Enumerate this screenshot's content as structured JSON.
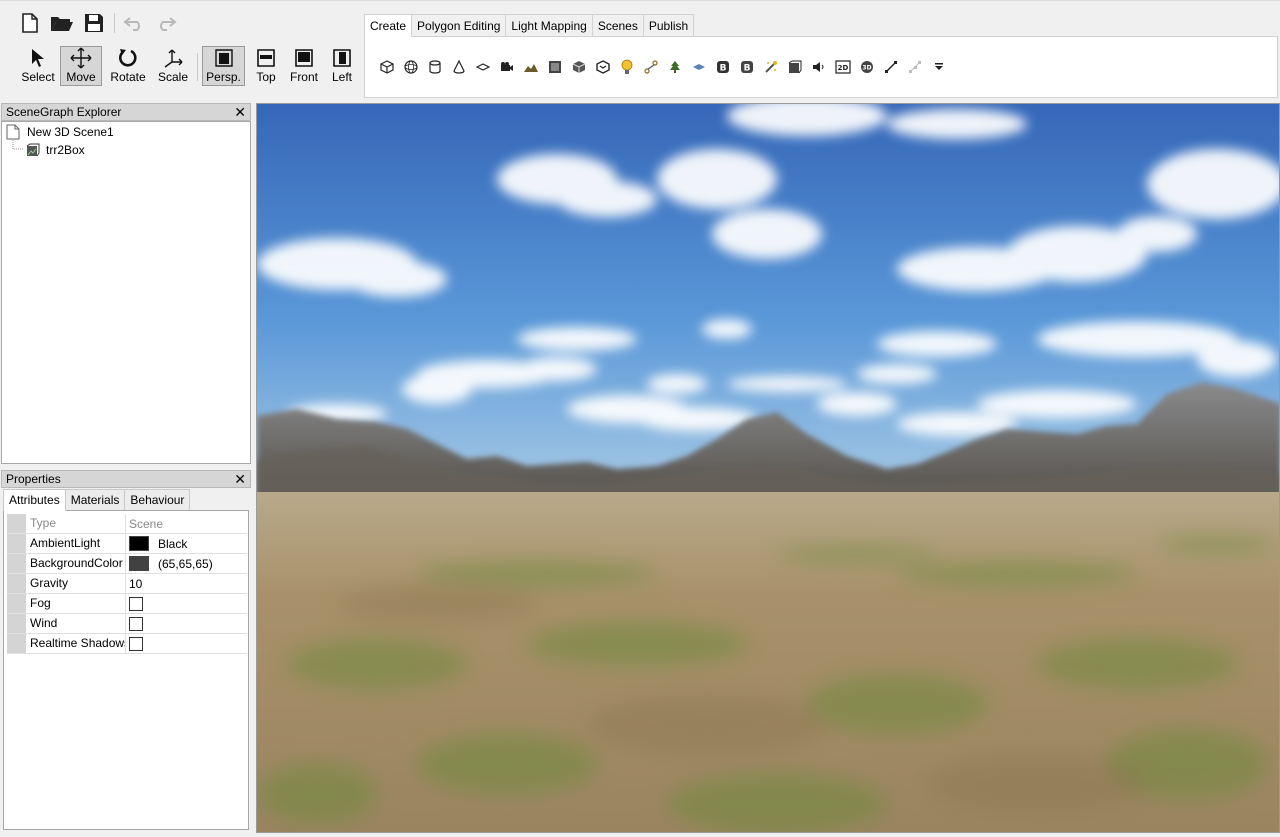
{
  "file_toolbar": {
    "buttons": [
      {
        "name": "new-file",
        "icon": "new-file-icon"
      },
      {
        "name": "open-folder",
        "icon": "folder-open-icon"
      },
      {
        "name": "save",
        "icon": "save-icon"
      },
      {
        "name": "undo",
        "icon": "undo-icon"
      },
      {
        "name": "redo",
        "icon": "redo-icon"
      }
    ]
  },
  "tools": {
    "select": "Select",
    "move": "Move",
    "rotate": "Rotate",
    "scale": "Scale",
    "persp": "Persp.",
    "top": "Top",
    "front": "Front",
    "left": "Left"
  },
  "ribbon": {
    "tabs": [
      "Create",
      "Polygon Editing",
      "Light Mapping",
      "Scenes",
      "Publish"
    ],
    "active_tab": "Create",
    "create_icons": [
      "cube-icon",
      "sphere-icon",
      "cylinder-icon",
      "cone-icon",
      "plane-icon",
      "camera-icon",
      "terrain-icon",
      "skybox-icon",
      "mesh-icon",
      "mesh-import-icon",
      "light-bulb-icon",
      "path-icon",
      "tree-icon",
      "water-icon",
      "billboard-icon",
      "billboard-2-icon",
      "particle-icon",
      "box-icon",
      "sound-icon",
      "2d-overlay-icon",
      "3d-overlay-icon",
      "line-icon",
      "nodes-icon",
      "more-icon"
    ],
    "badge_b1": "B",
    "badge_b2": "B",
    "badge_2d": "2D",
    "badge_3d": "3D"
  },
  "scenegraph": {
    "title": "SceneGraph Explorer",
    "close": "✕",
    "items": [
      {
        "label": "New 3D Scene1",
        "icon": "scene-file-icon"
      },
      {
        "label": "trr2Box",
        "icon": "terrain-node-icon"
      }
    ]
  },
  "properties": {
    "title": "Properties",
    "close": "✕",
    "tabs": [
      "Attributes",
      "Materials",
      "Behaviour"
    ],
    "active_tab": "Attributes",
    "header": {
      "name": "Type",
      "value": "Scene"
    },
    "rows": [
      {
        "name": "AmbientLight",
        "value": "Black",
        "kind": "color",
        "color": "#000000"
      },
      {
        "name": "BackgroundColor",
        "value": "(65,65,65)",
        "kind": "color",
        "color": "#414141"
      },
      {
        "name": "Gravity",
        "value": "10",
        "kind": "text"
      },
      {
        "name": "Fog",
        "value": false,
        "kind": "checkbox"
      },
      {
        "name": "Wind",
        "value": false,
        "kind": "checkbox"
      },
      {
        "name": "Realtime Shadows",
        "value": false,
        "kind": "checkbox"
      }
    ]
  },
  "viewport": {
    "sky_color_top": "#3c78c8",
    "sky_color_horizon": "#a8cce8",
    "ground_color": "#a08a60",
    "grass_color": "#6f8a3c"
  }
}
